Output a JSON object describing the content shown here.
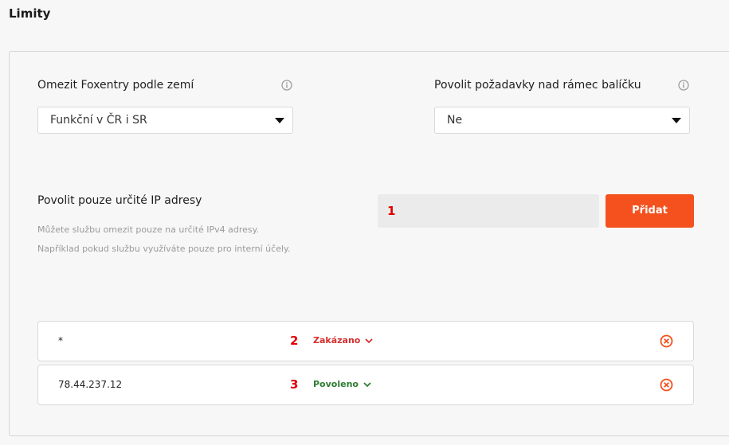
{
  "page": {
    "title": "Limity"
  },
  "country_limit": {
    "label": "Omezit Foxentry podle zemí",
    "selected": "Funkční v ČR i SR",
    "info_icon": "info-circle-icon"
  },
  "overage": {
    "label": "Povolit požadavky nad rámec balíčku",
    "selected": "Ne",
    "info_icon": "info-circle-icon"
  },
  "ip_section": {
    "title": "Povolit pouze určité IP adresy",
    "help_line1": "Můžete službu omezit pouze na určité IPv4 adresy.",
    "help_line2": "Například pokud službu využíváte pouze pro interní účely.",
    "input_value": "",
    "input_marker": "1",
    "add_button": "Přidat"
  },
  "ip_rows": [
    {
      "ip": "*",
      "marker": "2",
      "status": "Zakázano",
      "status_color": "#d32f2f"
    },
    {
      "ip": "78.44.237.12",
      "marker": "3",
      "status": "Povoleno",
      "status_color": "#2e7d32"
    }
  ],
  "colors": {
    "accent": "#f4511e",
    "remove_icon": "#f4511e",
    "marker": "#e00000"
  }
}
